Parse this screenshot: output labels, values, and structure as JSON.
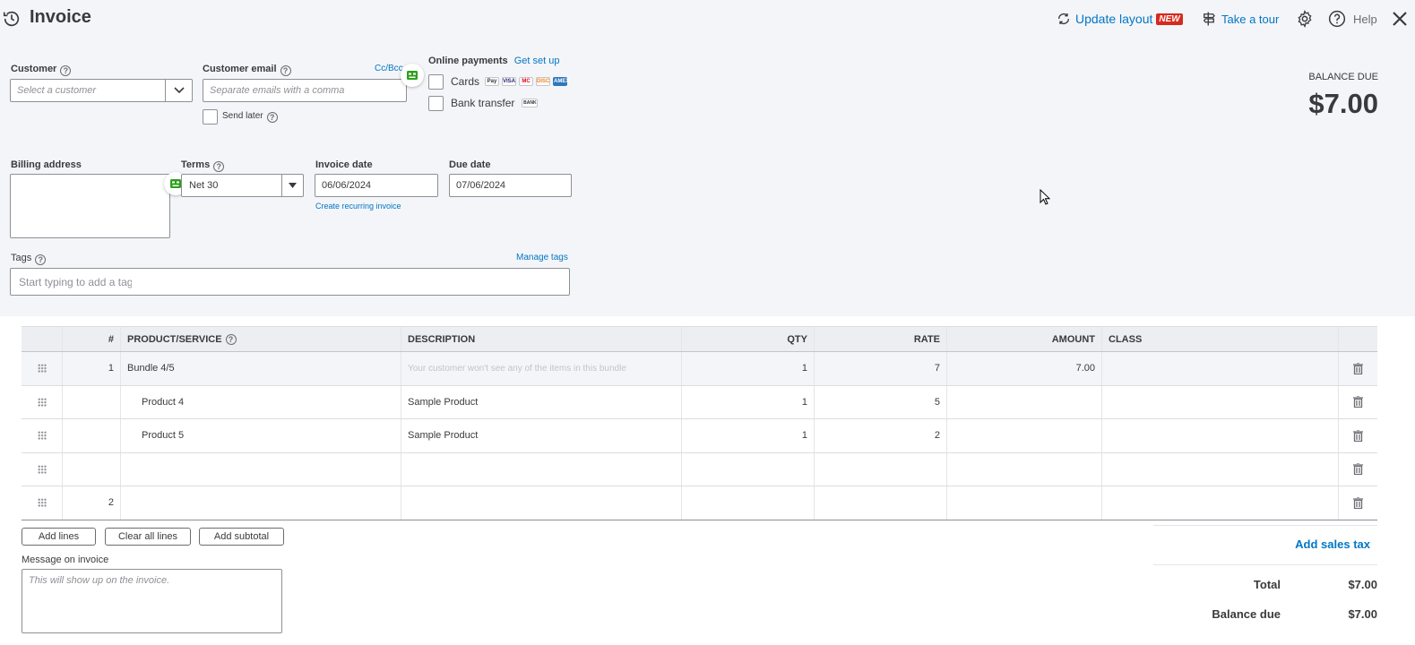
{
  "header": {
    "title": "Invoice",
    "update_layout": "Update layout",
    "new_badge": "NEW",
    "take_tour": "Take a tour",
    "help": "Help"
  },
  "customer": {
    "label": "Customer",
    "placeholder": "Select a customer"
  },
  "email": {
    "label": "Customer email",
    "placeholder": "Separate emails with a comma",
    "cc_bcc": "Cc/Bcc",
    "send_later": "Send later"
  },
  "payments": {
    "label": "Online payments",
    "setup_link": "Get set up",
    "cards": "Cards",
    "bank": "Bank transfer",
    "card_logos": [
      "Pay",
      "VISA",
      "MC",
      "DISC",
      "AMEX"
    ],
    "bank_logo": "BANK"
  },
  "balance": {
    "label": "BALANCE DUE",
    "amount": "$7.00"
  },
  "billing": {
    "label": "Billing address"
  },
  "terms": {
    "label": "Terms",
    "value": "Net 30"
  },
  "invoice_date": {
    "label": "Invoice date",
    "value": "06/06/2024",
    "recurring": "Create recurring invoice"
  },
  "due_date": {
    "label": "Due date",
    "value": "07/06/2024"
  },
  "tags": {
    "label": "Tags",
    "manage": "Manage tags",
    "placeholder": "Start typing to add a tag"
  },
  "table": {
    "headers": [
      "#",
      "PRODUCT/SERVICE",
      "DESCRIPTION",
      "QTY",
      "RATE",
      "AMOUNT",
      "CLASS"
    ],
    "rows": [
      {
        "num": "1",
        "product": "Bundle 4/5",
        "description": "Your customer won't see any of the items in this bundle",
        "qty": "1",
        "rate": "7",
        "amount": "7.00"
      },
      {
        "num": "",
        "product": "Product 4",
        "description": "Sample Product",
        "qty": "1",
        "rate": "5",
        "amount": ""
      },
      {
        "num": "",
        "product": "Product 5",
        "description": "Sample Product",
        "qty": "1",
        "rate": "2",
        "amount": ""
      },
      {
        "num": "",
        "product": "",
        "description": "",
        "qty": "",
        "rate": "",
        "amount": ""
      },
      {
        "num": "2",
        "product": "",
        "description": "",
        "qty": "",
        "rate": "",
        "amount": ""
      }
    ]
  },
  "actions": {
    "add_lines": "Add lines",
    "clear_lines": "Clear all lines",
    "add_subtotal": "Add subtotal"
  },
  "message": {
    "label": "Message on invoice",
    "placeholder": "This will show up on the invoice."
  },
  "totals": {
    "add_sales_tax": "Add sales tax",
    "total_label": "Total",
    "total_value": "$7.00",
    "balance_label": "Balance due",
    "balance_value": "$7.00"
  }
}
